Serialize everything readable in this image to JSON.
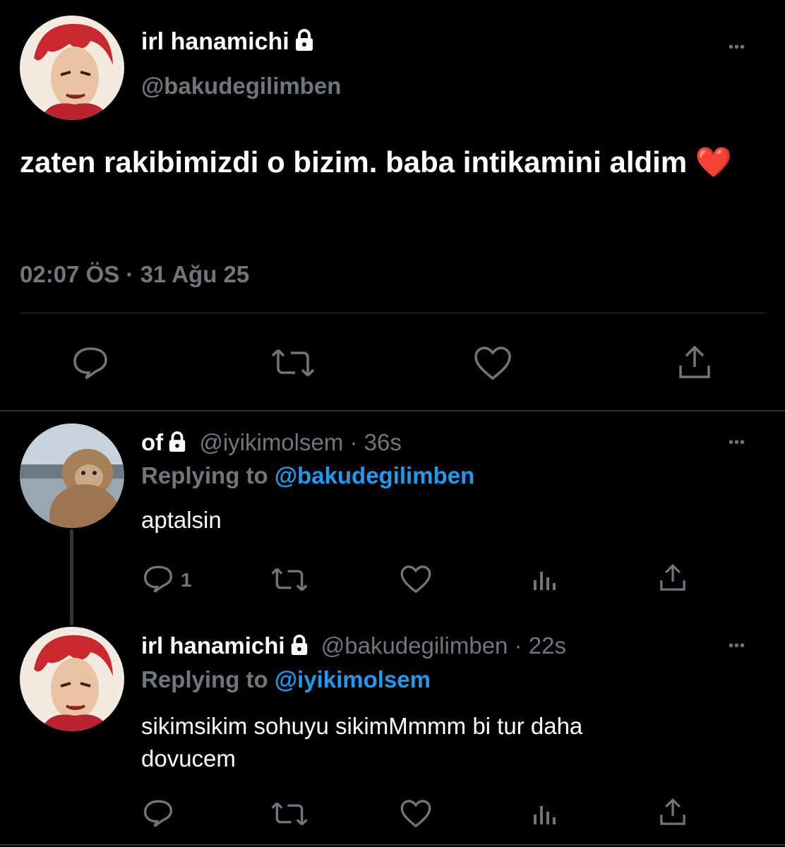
{
  "main_tweet": {
    "author_name": "irl hanamichi",
    "handle": "@bakudegilimben",
    "text": "zaten rakibimizdi o bizim. baba intikamini aldim",
    "emoji": "❤️",
    "timestamp": "02:07 ÖS · 31 Ağu 25"
  },
  "replies": [
    {
      "author_name": "of",
      "handle": "@iyikimolsem",
      "age": "· 36s",
      "replying_label": "Replying to",
      "replying_to": "@bakudegilimben",
      "text": "aptalsin",
      "reply_count": "1"
    },
    {
      "author_name": "irl hanamichi",
      "handle": "@bakudegilimben",
      "age": "· 22s",
      "replying_label": "Replying to",
      "replying_to": "@iyikimolsem",
      "text_line1": "sikimsikim sohuyu sikimMmmm bi tur daha",
      "text_line2": "dovucem",
      "reply_count": ""
    }
  ],
  "more_glyph": "•••",
  "colors": {
    "background": "#000000",
    "accent": "#1d9bf0",
    "secondary": "#71767b",
    "separator": "#2f3336"
  },
  "icons": [
    "reply-icon",
    "retweet-icon",
    "like-icon",
    "share-icon",
    "analytics-icon",
    "lock-icon",
    "more-icon"
  ]
}
